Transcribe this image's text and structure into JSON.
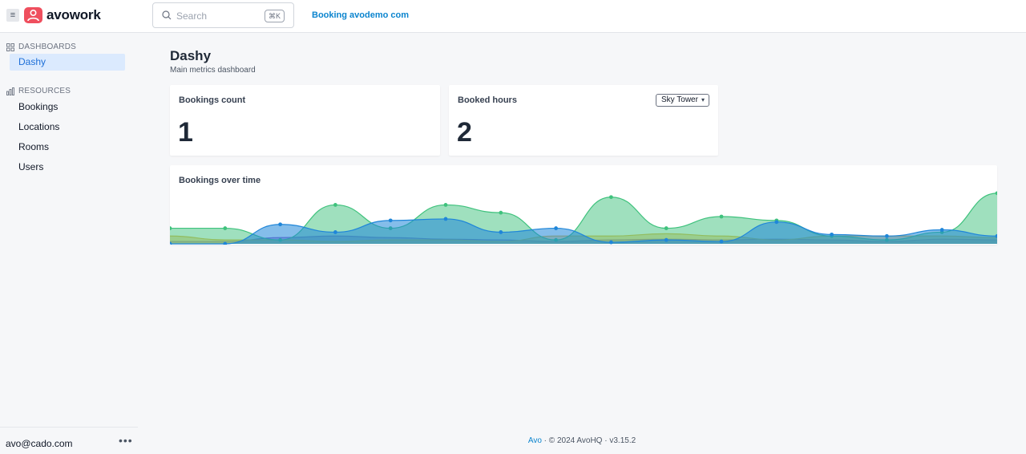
{
  "app": {
    "name": "avowork"
  },
  "header": {
    "search_placeholder": "Search",
    "search_shortcut": "⌘K",
    "link_label": "Booking avodemo com"
  },
  "sidebar": {
    "dashboards_title": "DASHBOARDS",
    "dashboards": [
      {
        "label": "Dashy",
        "active": true
      }
    ],
    "resources_title": "RESOURCES",
    "resources": [
      {
        "label": "Bookings"
      },
      {
        "label": "Locations"
      },
      {
        "label": "Rooms"
      },
      {
        "label": "Users"
      }
    ],
    "user_email": "avo@cado.com",
    "user_menu": "•••"
  },
  "page": {
    "title": "Dashy",
    "subtitle": "Main metrics dashboard"
  },
  "cards": {
    "bookings_count": {
      "title": "Bookings count",
      "value": "1"
    },
    "booked_hours": {
      "title": "Booked hours",
      "value": "2",
      "filter_value": "Sky Tower"
    },
    "bookings_over_time": {
      "title": "Bookings over time"
    }
  },
  "chart_data": {
    "type": "area",
    "title": "Bookings over time",
    "x_count": 16,
    "ylim": [
      0,
      7
    ],
    "series": [
      {
        "values": [
          2,
          2,
          0.5,
          5,
          2,
          5,
          4,
          0.5,
          6,
          2,
          3.5,
          3,
          1,
          0.5,
          1.5,
          6.5
        ],
        "color": "#3fc27d"
      },
      {
        "values": [
          0,
          0,
          2.5,
          1.5,
          3,
          3.2,
          1.5,
          2,
          0.2,
          0.5,
          0.3,
          2.8,
          1.2,
          1,
          1.8,
          1
        ],
        "color": "#1f86d9"
      },
      {
        "values": [
          1,
          0.5,
          0.5,
          0.3,
          0.5,
          0.5,
          0.3,
          1,
          1,
          1.3,
          1,
          0.5,
          1,
          1,
          1,
          0.8
        ],
        "color": "#e5b840"
      },
      {
        "values": [
          0.3,
          0.3,
          0.8,
          1,
          0.8,
          0.6,
          0.5,
          0.3,
          0.5,
          0.6,
          0.5,
          0.6,
          0.5,
          0.3,
          0.6,
          0.5
        ],
        "color": "#8b5cc7"
      }
    ]
  },
  "footer": {
    "link": "Avo",
    "text": " · © 2024 AvoHQ · v3.15.2"
  }
}
